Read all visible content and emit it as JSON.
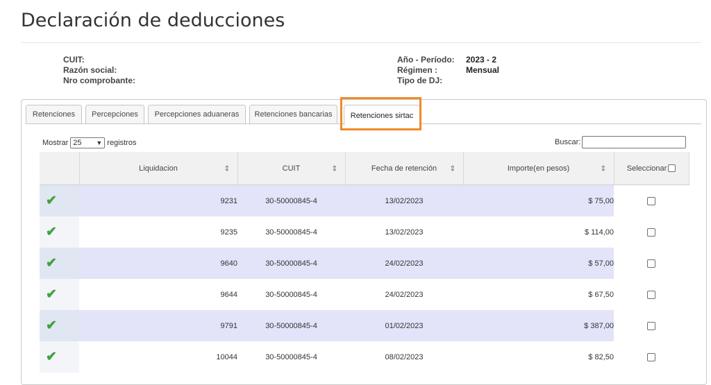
{
  "page": {
    "title": "Declaración de deducciones"
  },
  "info": {
    "left_labels": [
      "CUIT:",
      "Razón social:",
      "Nro comprobante:"
    ],
    "right_labels": [
      "Año - Período:",
      "Régimen :",
      "Tipo de DJ:"
    ],
    "right_values": [
      "2023 - 2",
      "Mensual",
      ""
    ]
  },
  "tabs": [
    {
      "label": "Retenciones",
      "active": false
    },
    {
      "label": "Percepciones",
      "active": false
    },
    {
      "label": "Percepciones aduaneras",
      "active": false
    },
    {
      "label": "Retenciones bancarias",
      "active": false
    },
    {
      "label": "Retenciones sirtac",
      "active": true
    }
  ],
  "highlight_color": "#f0892a",
  "controls": {
    "show_label": "Mostrar",
    "show_value": "25",
    "show_suffix": "registros",
    "search_label": "Buscar:",
    "search_value": ""
  },
  "table": {
    "columns": [
      "",
      "Liquidacion",
      "CUIT",
      "Fecha de retención",
      "Importe(en pesos)",
      "Seleccionar"
    ],
    "rows": [
      {
        "liquidacion": "9231",
        "cuit": "30-50000845-4",
        "fecha": "13/02/2023",
        "importe": "$ 75,00"
      },
      {
        "liquidacion": "9235",
        "cuit": "30-50000845-4",
        "fecha": "13/02/2023",
        "importe": "$ 114,00"
      },
      {
        "liquidacion": "9640",
        "cuit": "30-50000845-4",
        "fecha": "24/02/2023",
        "importe": "$ 57,00"
      },
      {
        "liquidacion": "9644",
        "cuit": "30-50000845-4",
        "fecha": "24/02/2023",
        "importe": "$ 67,50"
      },
      {
        "liquidacion": "9791",
        "cuit": "30-50000845-4",
        "fecha": "01/02/2023",
        "importe": "$ 387,00"
      },
      {
        "liquidacion": "10044",
        "cuit": "30-50000845-4",
        "fecha": "08/02/2023",
        "importe": "$ 82,50"
      }
    ],
    "status_icon": "check-icon",
    "status_color": "#3fa33a"
  }
}
